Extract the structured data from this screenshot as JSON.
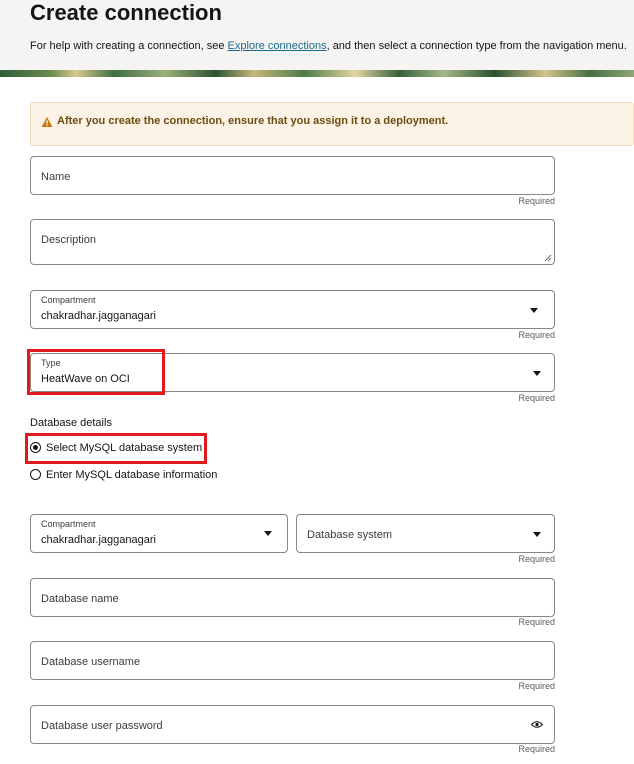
{
  "page": {
    "title": "Create connection",
    "help_prefix": "For help with creating a connection, see ",
    "help_link": "Explore connections",
    "help_suffix": ", and then select a connection type from the navigation menu."
  },
  "warning": {
    "text": "After you create the connection, ensure that you assign it to a deployment.",
    "color": "#fcf3e6"
  },
  "form": {
    "name": {
      "placeholder": "Name",
      "required": "Required"
    },
    "description": {
      "placeholder": "Description"
    },
    "compartment": {
      "label": "Compartment",
      "value": "chakradhar.jagganagari",
      "required": "Required"
    },
    "type": {
      "label": "Type",
      "value": "HeatWave on OCI",
      "required": "Required"
    },
    "database_details": {
      "label": "Database details",
      "options": [
        {
          "label": "Select MySQL database system",
          "checked": true
        },
        {
          "label": "Enter MySQL database information",
          "checked": false
        }
      ]
    },
    "db_compartment": {
      "label": "Compartment",
      "value": "chakradhar.jagganagari"
    },
    "db_system": {
      "placeholder": "Database system",
      "required": "Required"
    },
    "db_name": {
      "placeholder": "Database name",
      "required": "Required"
    },
    "db_username": {
      "placeholder": "Database username",
      "required": "Required"
    },
    "db_password": {
      "placeholder": "Database user password",
      "required": "Required",
      "icon": "eye-icon"
    }
  },
  "colors": {
    "highlight": "#e0191f",
    "link": "#1a6b8a"
  }
}
